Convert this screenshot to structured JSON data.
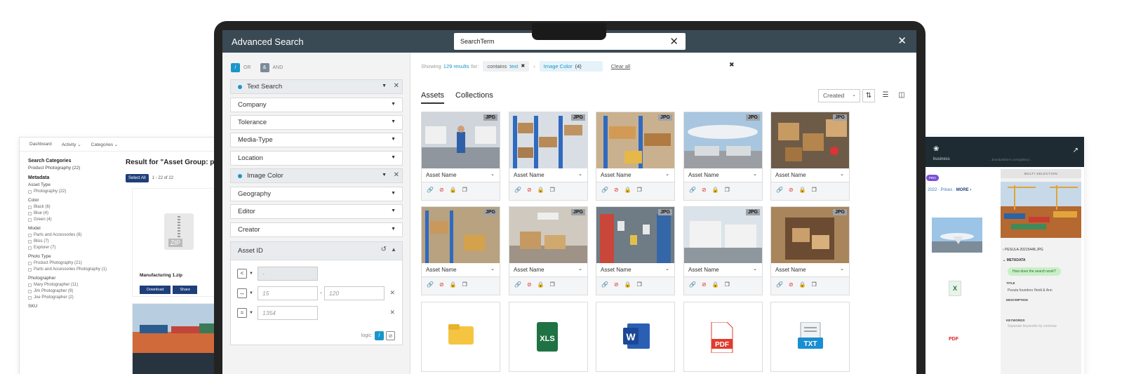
{
  "left_window": {
    "nav": [
      "Dashboard",
      "Activity ⌄",
      "Categories ⌄"
    ],
    "search_categories": "Search Categories",
    "product_photography": "Product Photography (22)",
    "metadata": "Metadata",
    "asset_type": "Asset Type",
    "asset_type_items": [
      "Photography (22)"
    ],
    "color": "Color",
    "color_items": [
      "Black (6)",
      "Blue (4)",
      "Green (4)"
    ],
    "model": "Model",
    "model_items": [
      "Parts and Accessories (8)",
      "Bliss (7)",
      "Explorer (7)"
    ],
    "photo_type": "Photo Type",
    "photo_type_items": [
      "Product Photography (21)",
      "Parts and Accessories Photography (1)"
    ],
    "photographer": "Photographer",
    "photographer_items": [
      "Mary Photographer (11)",
      "Jim Photographer (9)",
      "Joe Photographer (2)"
    ],
    "sku": "SKU",
    "result_title": "Result for \"Asset Group: p",
    "select_all": "Select All",
    "range": "1 - 22 of 22",
    "zip_label": "ZIP",
    "file_name": "Manufacturing 1.zip",
    "download": "Download",
    "share": "Share"
  },
  "right_window": {
    "brand": "business",
    "url": "...brandplatform.com/gallery/...",
    "pill": "PRO",
    "breadcrumb": "2022 · Prices ·",
    "more": "MORE",
    "multi_selection": "MULTI SELECTION",
    "file_name": "PESULA-20215448.JPG",
    "metadata": "METADATA",
    "chat_bubble": "How does the search work?",
    "title_label": "TITLE",
    "title_value": "Pesula founders Heidi & Ann",
    "description_label": "DESCRIPTION",
    "keywords_label": "KEYWORDS",
    "keywords_hint": "Separate keywords by commas",
    "pdf": "PDF"
  },
  "window": {
    "title": "Advanced Search",
    "search_value": "SearchTerm"
  },
  "filters": {
    "or_label": "OR",
    "and_label": "AND",
    "rows": [
      {
        "label": "Text Search",
        "active": true
      },
      {
        "label": "Company"
      },
      {
        "label": "Tolerance"
      },
      {
        "label": "Media-Type"
      },
      {
        "label": "Location"
      },
      {
        "label": "Image Color",
        "active": true
      },
      {
        "label": "Geography"
      },
      {
        "label": "Editor"
      },
      {
        "label": "Creator"
      }
    ],
    "asset_id": {
      "label": "Asset ID",
      "ops": [
        "<",
        "↔",
        "="
      ],
      "placeholder_1": "-",
      "range_from": "15",
      "range_to": "120",
      "equals": "1354"
    },
    "logic_label": "logic:"
  },
  "results": {
    "showing_prefix": "Showing",
    "count": "129 results",
    "for": "for:",
    "chip1_prefix": "contains",
    "chip1_term": "text",
    "chip2": "Image Color",
    "chip2_count": "(4)",
    "clear_all": "Clear all",
    "tabs": [
      "Assets",
      "Collections"
    ],
    "sort": "Created",
    "badge": "JPG",
    "asset_name": "Asset Name",
    "file_types": [
      "folder",
      "XLS",
      "W",
      "PDF",
      "TXT"
    ]
  },
  "colors": {
    "titlebar": "#3a4a55",
    "accent": "#1a96c8",
    "filter_bg": "#f3f3f4"
  }
}
